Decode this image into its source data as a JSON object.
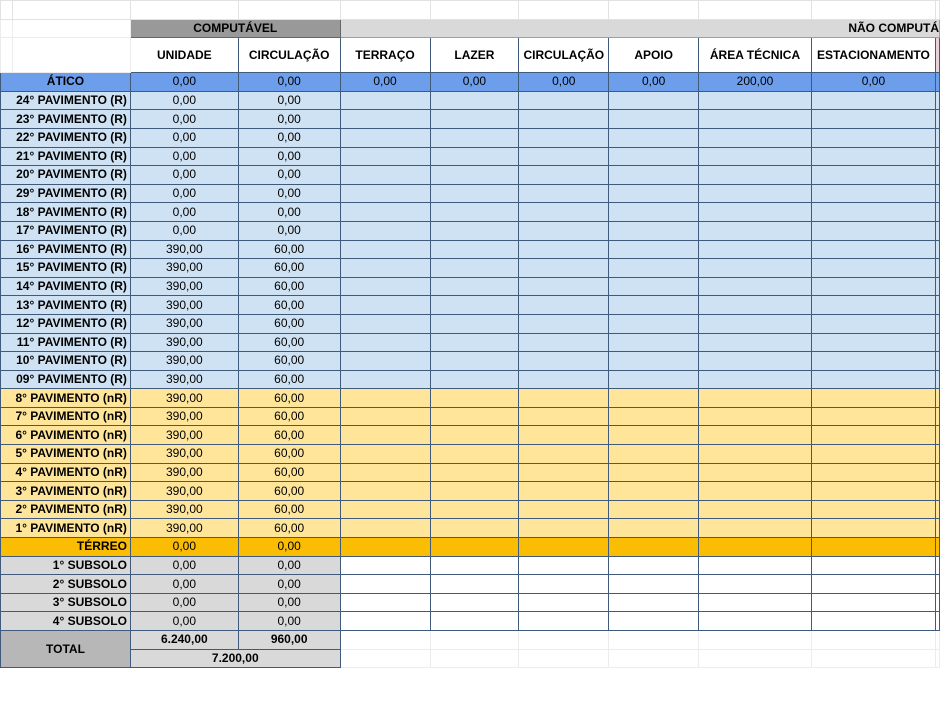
{
  "headers": {
    "computavel": "COMPUTÁVEL",
    "nao_computavel": "NÃO COMPUTÁ",
    "columns": [
      "UNIDADE",
      "CIRCULAÇÃO",
      "TERRAÇO",
      "LAZER",
      "CIRCULAÇÃO",
      "APOIO",
      "ÁREA TÉCNICA",
      "ESTACIONAMENTO"
    ]
  },
  "atico": {
    "label": "ÁTICO",
    "values": [
      "0,00",
      "0,00",
      "0,00",
      "0,00",
      "0,00",
      "0,00",
      "200,00",
      "0,00"
    ]
  },
  "rows_blue": [
    {
      "label": "24° PAVIMENTO (R)",
      "unidade": "0,00",
      "circulacao": "0,00"
    },
    {
      "label": "23° PAVIMENTO (R)",
      "unidade": "0,00",
      "circulacao": "0,00"
    },
    {
      "label": "22° PAVIMENTO (R)",
      "unidade": "0,00",
      "circulacao": "0,00"
    },
    {
      "label": "21° PAVIMENTO (R)",
      "unidade": "0,00",
      "circulacao": "0,00"
    },
    {
      "label": "20° PAVIMENTO (R)",
      "unidade": "0,00",
      "circulacao": "0,00"
    },
    {
      "label": "29° PAVIMENTO (R)",
      "unidade": "0,00",
      "circulacao": "0,00"
    },
    {
      "label": "18° PAVIMENTO (R)",
      "unidade": "0,00",
      "circulacao": "0,00"
    },
    {
      "label": "17° PAVIMENTO (R)",
      "unidade": "0,00",
      "circulacao": "0,00"
    },
    {
      "label": "16° PAVIMENTO (R)",
      "unidade": "390,00",
      "circulacao": "60,00"
    },
    {
      "label": "15° PAVIMENTO (R)",
      "unidade": "390,00",
      "circulacao": "60,00"
    },
    {
      "label": "14° PAVIMENTO (R)",
      "unidade": "390,00",
      "circulacao": "60,00"
    },
    {
      "label": "13° PAVIMENTO (R)",
      "unidade": "390,00",
      "circulacao": "60,00"
    },
    {
      "label": "12° PAVIMENTO (R)",
      "unidade": "390,00",
      "circulacao": "60,00"
    },
    {
      "label": "11° PAVIMENTO (R)",
      "unidade": "390,00",
      "circulacao": "60,00"
    },
    {
      "label": "10° PAVIMENTO (R)",
      "unidade": "390,00",
      "circulacao": "60,00"
    },
    {
      "label": "09° PAVIMENTO (R)",
      "unidade": "390,00",
      "circulacao": "60,00"
    }
  ],
  "rows_yellow": [
    {
      "label": "8° PAVIMENTO (nR)",
      "unidade": "390,00",
      "circulacao": "60,00"
    },
    {
      "label": "7° PAVIMENTO (nR)",
      "unidade": "390,00",
      "circulacao": "60,00"
    },
    {
      "label": "6° PAVIMENTO (nR)",
      "unidade": "390,00",
      "circulacao": "60,00"
    },
    {
      "label": "5° PAVIMENTO (nR)",
      "unidade": "390,00",
      "circulacao": "60,00"
    },
    {
      "label": "4° PAVIMENTO (nR)",
      "unidade": "390,00",
      "circulacao": "60,00"
    },
    {
      "label": "3° PAVIMENTO (nR)",
      "unidade": "390,00",
      "circulacao": "60,00"
    },
    {
      "label": "2° PAVIMENTO (nR)",
      "unidade": "390,00",
      "circulacao": "60,00"
    },
    {
      "label": "1° PAVIMENTO (nR)",
      "unidade": "390,00",
      "circulacao": "60,00"
    }
  ],
  "terreo": {
    "label": "TÉRREO",
    "unidade": "0,00",
    "circulacao": "0,00"
  },
  "subsolos": [
    {
      "label": "1° SUBSOLO",
      "unidade": "0,00",
      "circulacao": "0,00"
    },
    {
      "label": "2° SUBSOLO",
      "unidade": "0,00",
      "circulacao": "0,00"
    },
    {
      "label": "3° SUBSOLO",
      "unidade": "0,00",
      "circulacao": "0,00"
    },
    {
      "label": "4° SUBSOLO",
      "unidade": "0,00",
      "circulacao": "0,00"
    }
  ],
  "total": {
    "label": "TOTAL",
    "unidade": "6.240,00",
    "circulacao": "960,00",
    "sum": "7.200,00"
  },
  "colors": {
    "blue_row": "#cfe2f3",
    "yellow_row": "#ffe599",
    "terreo": "#fbbc04",
    "atico": "#6d9eeb",
    "subsolo": "#d9d9d9",
    "header_dark": "#999999"
  }
}
